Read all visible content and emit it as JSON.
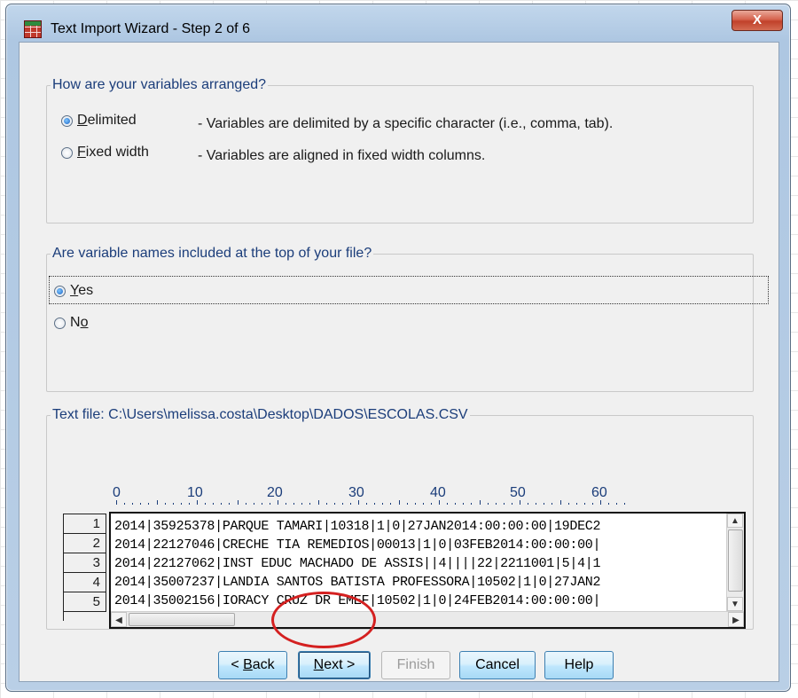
{
  "window": {
    "title": "Text Import Wizard - Step 2 of 6",
    "close_label": "X"
  },
  "arrangement": {
    "legend": "How are your variables arranged?",
    "options": [
      {
        "label": "Delimited",
        "mnemonic": "D",
        "rest": "elimited",
        "checked": true,
        "description": "- Variables are delimited by a specific character (i.e., comma, tab)."
      },
      {
        "label": "Fixed width",
        "mnemonic": "F",
        "rest": "ixed width",
        "checked": false,
        "description": "- Variables are aligned in fixed width columns."
      }
    ]
  },
  "names": {
    "legend": "Are variable names included at the top of your file?",
    "options": [
      {
        "label": "Yes",
        "mnemonic": "Y",
        "rest": "es",
        "checked": true
      },
      {
        "label": "No",
        "lead": "N",
        "mnemonic": "o",
        "checked": false
      }
    ]
  },
  "textfile": {
    "legend": "Text file:  C:\\Users\\melissa.costa\\Desktop\\DADOS\\ESCOLAS.CSV",
    "ruler": [
      "0",
      "10",
      "20",
      "30",
      "40",
      "50",
      "60"
    ],
    "line_numbers": [
      "1",
      "2",
      "3",
      "4",
      "5"
    ],
    "lines": [
      "2014|35925378|PARQUE TAMARI|10318|1|0|27JAN2014:00:00:00|19DEC2",
      "2014|22127046|CRECHE TIA REMEDIOS|00013|1|0|03FEB2014:00:00:00|",
      "2014|22127062|INST EDUC MACHADO DE ASSIS||4||||22|2211001|5|4|1",
      "2014|35007237|LANDIA SANTOS BATISTA PROFESSORA|10502|1|0|27JAN2",
      "2014|35002156|IORACY CRUZ DR EMEF|10502|1|0|24FEB2014:00:00:00|"
    ]
  },
  "buttons": {
    "back": {
      "lead": "< ",
      "mnemonic": "B",
      "rest": "ack"
    },
    "next": {
      "mnemonic": "N",
      "rest": "ext >"
    },
    "finish": "Finish",
    "cancel": "Cancel",
    "help": "Help"
  },
  "colors": {
    "accent_text": "#1b3d7a",
    "annotation": "#d42020"
  }
}
